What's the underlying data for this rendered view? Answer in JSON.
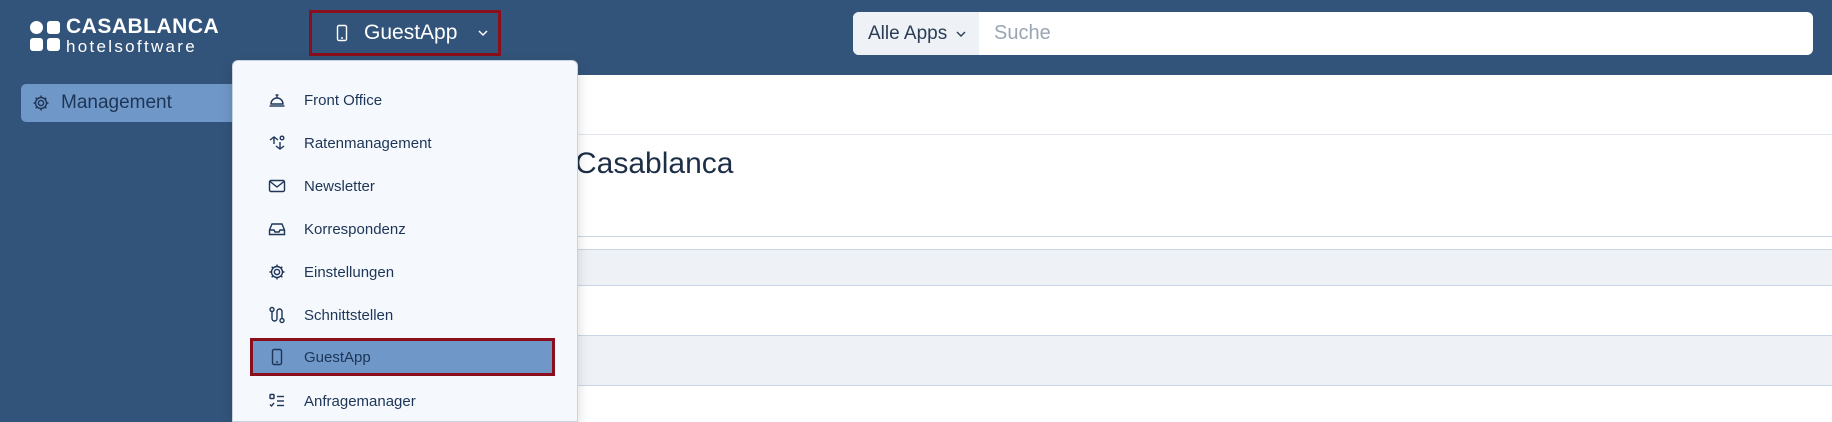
{
  "logo": {
    "line1": "CASABLANCA",
    "line2": "hotelsoftware"
  },
  "app_switcher": {
    "label": "GuestApp",
    "icon": "phone-icon"
  },
  "search": {
    "scope": "Alle Apps",
    "placeholder": "Suche",
    "value": ""
  },
  "sidebar": {
    "items": [
      {
        "label": "Management",
        "icon": "gear-icon"
      }
    ]
  },
  "content": {
    "title": "Casablanca"
  },
  "app_menu": {
    "items": [
      {
        "label": "Front Office",
        "icon": "bell-icon",
        "active": false
      },
      {
        "label": "Ratenmanagement",
        "icon": "rate-icon",
        "active": false
      },
      {
        "label": "Newsletter",
        "icon": "mail-icon",
        "active": false
      },
      {
        "label": "Korrespondenz",
        "icon": "inbox-icon",
        "active": false
      },
      {
        "label": "Einstellungen",
        "icon": "gear-icon",
        "active": false
      },
      {
        "label": "Schnittstellen",
        "icon": "route-icon",
        "active": false
      },
      {
        "label": "GuestApp",
        "icon": "phone-icon",
        "active": true
      },
      {
        "label": "Anfragemanager",
        "icon": "checklist-icon",
        "active": false
      }
    ]
  },
  "colors": {
    "topbar": "#33547a",
    "active": "#6f97c7",
    "highlight_border": "#8a0e1c"
  }
}
